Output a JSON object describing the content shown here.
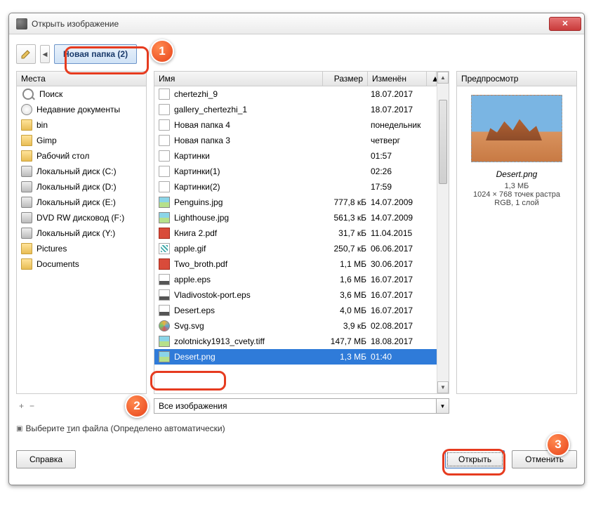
{
  "title": "Открыть изображение",
  "breadcrumb": "Новая папка (2)",
  "places_header": "Места",
  "places": [
    {
      "icon": "search",
      "label": "Поиск"
    },
    {
      "icon": "recent",
      "label": "Недавние документы"
    },
    {
      "icon": "folder",
      "label": "bin"
    },
    {
      "icon": "folder",
      "label": "Gimp"
    },
    {
      "icon": "folder",
      "label": "Рабочий стол"
    },
    {
      "icon": "drive",
      "label": "Локальный диск (C:)"
    },
    {
      "icon": "drive",
      "label": "Локальный диск (D:)"
    },
    {
      "icon": "drive",
      "label": "Локальный диск (E:)"
    },
    {
      "icon": "drive",
      "label": "DVD RW дисковод (F:)"
    },
    {
      "icon": "drive",
      "label": "Локальный диск (Y:)"
    },
    {
      "icon": "folder",
      "label": "Pictures"
    },
    {
      "icon": "folder",
      "label": "Documents"
    }
  ],
  "cols": {
    "name": "Имя",
    "size": "Размер",
    "date": "Изменён"
  },
  "files": [
    {
      "icon": "doc",
      "name": "chertezhi_9",
      "size": "",
      "date": "18.07.2017"
    },
    {
      "icon": "doc",
      "name": "gallery_chertezhi_1",
      "size": "",
      "date": "18.07.2017"
    },
    {
      "icon": "doc",
      "name": "Новая папка 4",
      "size": "",
      "date": "понедельник"
    },
    {
      "icon": "doc",
      "name": "Новая папка 3",
      "size": "",
      "date": "четверг"
    },
    {
      "icon": "doc",
      "name": "Картинки",
      "size": "",
      "date": "01:57"
    },
    {
      "icon": "doc",
      "name": "Картинки(1)",
      "size": "",
      "date": "02:26"
    },
    {
      "icon": "doc",
      "name": "Картинки(2)",
      "size": "",
      "date": "17:59"
    },
    {
      "icon": "img",
      "name": "Penguins.jpg",
      "size": "777,8 кБ",
      "date": "14.07.2009"
    },
    {
      "icon": "img",
      "name": "Lighthouse.jpg",
      "size": "561,3 кБ",
      "date": "14.07.2009"
    },
    {
      "icon": "pdf",
      "name": "Книга 2.pdf",
      "size": "31,7 кБ",
      "date": "11.04.2015"
    },
    {
      "icon": "gif",
      "name": "apple.gif",
      "size": "250,7 кБ",
      "date": "06.06.2017"
    },
    {
      "icon": "pdf",
      "name": "Two_broth.pdf",
      "size": "1,1 МБ",
      "date": "30.06.2017"
    },
    {
      "icon": "eps",
      "name": "apple.eps",
      "size": "1,6 МБ",
      "date": "16.07.2017"
    },
    {
      "icon": "eps",
      "name": "Vladivostok-port.eps",
      "size": "3,6 МБ",
      "date": "16.07.2017"
    },
    {
      "icon": "eps",
      "name": "Desert.eps",
      "size": "4,0 МБ",
      "date": "16.07.2017"
    },
    {
      "icon": "svg",
      "name": "Svg.svg",
      "size": "3,9 кБ",
      "date": "02.08.2017"
    },
    {
      "icon": "img",
      "name": "zolotnicky1913_cvety.tiff",
      "size": "147,7 МБ",
      "date": "18.08.2017"
    },
    {
      "icon": "img",
      "name": "Desert.png",
      "size": "1,3 МБ",
      "date": "01:40",
      "selected": true
    }
  ],
  "preview": {
    "header": "Предпросмотр",
    "name": "Desert.png",
    "size": "1,3 МБ",
    "dims": "1024 × 768 точек растра",
    "mode": "RGB, 1 слой"
  },
  "filter": "Все изображения",
  "filetype_label_pre": "Выберите ",
  "filetype_label_u": "т",
  "filetype_label_post": "ип файла (Определено автоматически)",
  "add": "+",
  "remove": "−",
  "buttons": {
    "help": "Справка",
    "open": "Открыть",
    "cancel": "Отменить"
  },
  "badges": {
    "b1": "1",
    "b2": "2",
    "b3": "3"
  }
}
